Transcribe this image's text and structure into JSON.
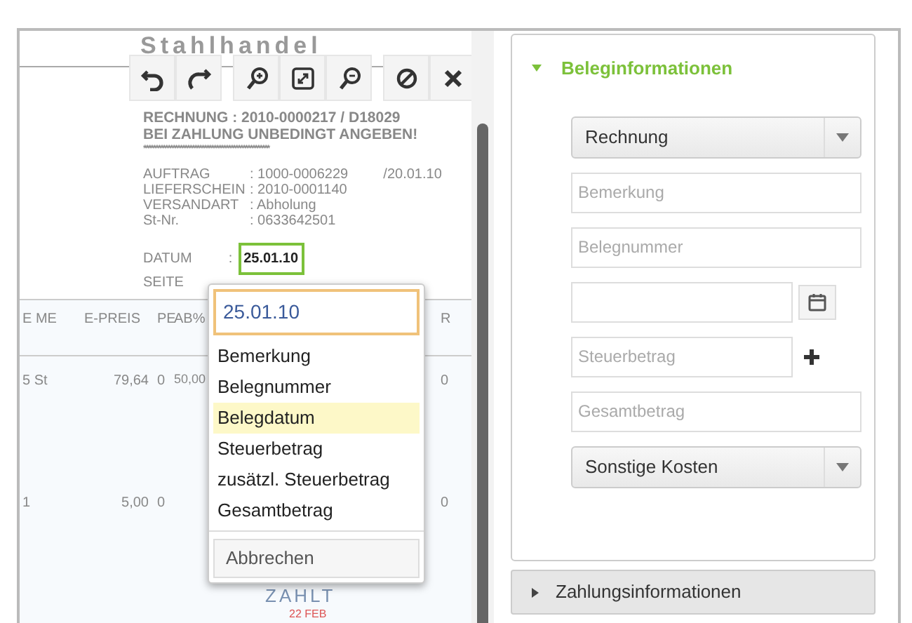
{
  "document": {
    "heading": "Stahlhandel",
    "invoice_lines": [
      "RECHNUNG : 2010-0000217     / D18029",
      "BEI ZAHLUNG UNBEDINGT ANGEBEN!",
      "****************************************************"
    ],
    "details": [
      {
        "label": "AUFTRAG",
        "value": ": 1000-0006229",
        "extra": "/20.01.10"
      },
      {
        "label": "LIEFERSCHEIN",
        "value": ": 2010-0001140"
      },
      {
        "label": "VERSANDART",
        "value": ": Abholung"
      },
      {
        "label": "St-Nr.",
        "value": ": 0633642501"
      }
    ],
    "date": {
      "label": "DATUM",
      "separator": ":",
      "value": "25.01.10"
    },
    "page_label": "SEITE",
    "columns": [
      "E ME",
      "E-PREIS",
      "PE",
      "AB%",
      "R"
    ],
    "rows": [
      [
        "5 St",
        "79,64",
        "0",
        "50,00",
        "0"
      ],
      [
        "1",
        "5,00",
        "0",
        "",
        "0"
      ]
    ],
    "stamp": {
      "text": "ZAHLT",
      "date": "22 FEB"
    }
  },
  "toolbar": [
    {
      "kind": "undo"
    },
    {
      "kind": "redo"
    },
    {
      "kind": "zoom-in"
    },
    {
      "kind": "fit"
    },
    {
      "kind": "zoom-out"
    },
    {
      "kind": "cancel"
    },
    {
      "kind": "close"
    }
  ],
  "popup": {
    "value": "25.01.10",
    "options": [
      {
        "label": "Bemerkung",
        "selected": false
      },
      {
        "label": "Belegnummer",
        "selected": false
      },
      {
        "label": "Belegdatum",
        "selected": true
      },
      {
        "label": "Steuerbetrag",
        "selected": false
      },
      {
        "label": "zusätzl. Steuerbetrag",
        "selected": false
      },
      {
        "label": "Gesamtbetrag",
        "selected": false
      }
    ],
    "cancel": "Abbrechen"
  },
  "panels": [
    {
      "title": "Beleginformationen",
      "expanded": true,
      "fields": [
        {
          "kind": "select",
          "value": "Rechnung"
        },
        {
          "kind": "input",
          "placeholder": "Bemerkung"
        },
        {
          "kind": "input",
          "placeholder": "Belegnummer"
        },
        {
          "kind": "date"
        },
        {
          "kind": "input_add",
          "placeholder": "Steuerbetrag"
        },
        {
          "kind": "input",
          "placeholder": "Gesamtbetrag"
        },
        {
          "kind": "select",
          "value": "Sonstige Kosten"
        }
      ]
    },
    {
      "title": "Zahlungsinformationen",
      "expanded": false
    }
  ]
}
